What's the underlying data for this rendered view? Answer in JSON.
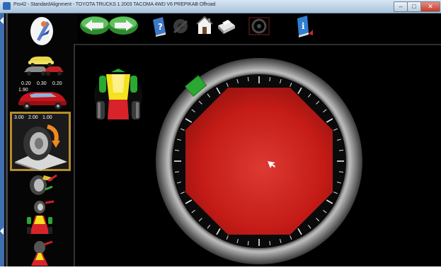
{
  "window": {
    "title": "Pro42 - StandardAlignment - TOYOTA TRUCKS 1 2003 TACOMA 4WD V6 PREPIKAB Offroad"
  },
  "sidebar": {
    "measure_readouts": [
      "0.20",
      "0.30",
      "0.20"
    ],
    "measure_sub": "1.90",
    "caster_readouts": [
      "3.00",
      "2.00",
      "1.00"
    ]
  },
  "colors": {
    "gauge_face": "#c41b16",
    "target_green": "#2aa832",
    "highlight_border": "#b58d2b",
    "car_yellow": "#f4e21c",
    "car_red": "#d8232a"
  },
  "icons": {
    "back": "left-arrow-icon",
    "next": "right-arrow-icon",
    "help": "help-book-icon",
    "home": "home-icon",
    "print": "printer-icon",
    "info": "info-icon"
  }
}
